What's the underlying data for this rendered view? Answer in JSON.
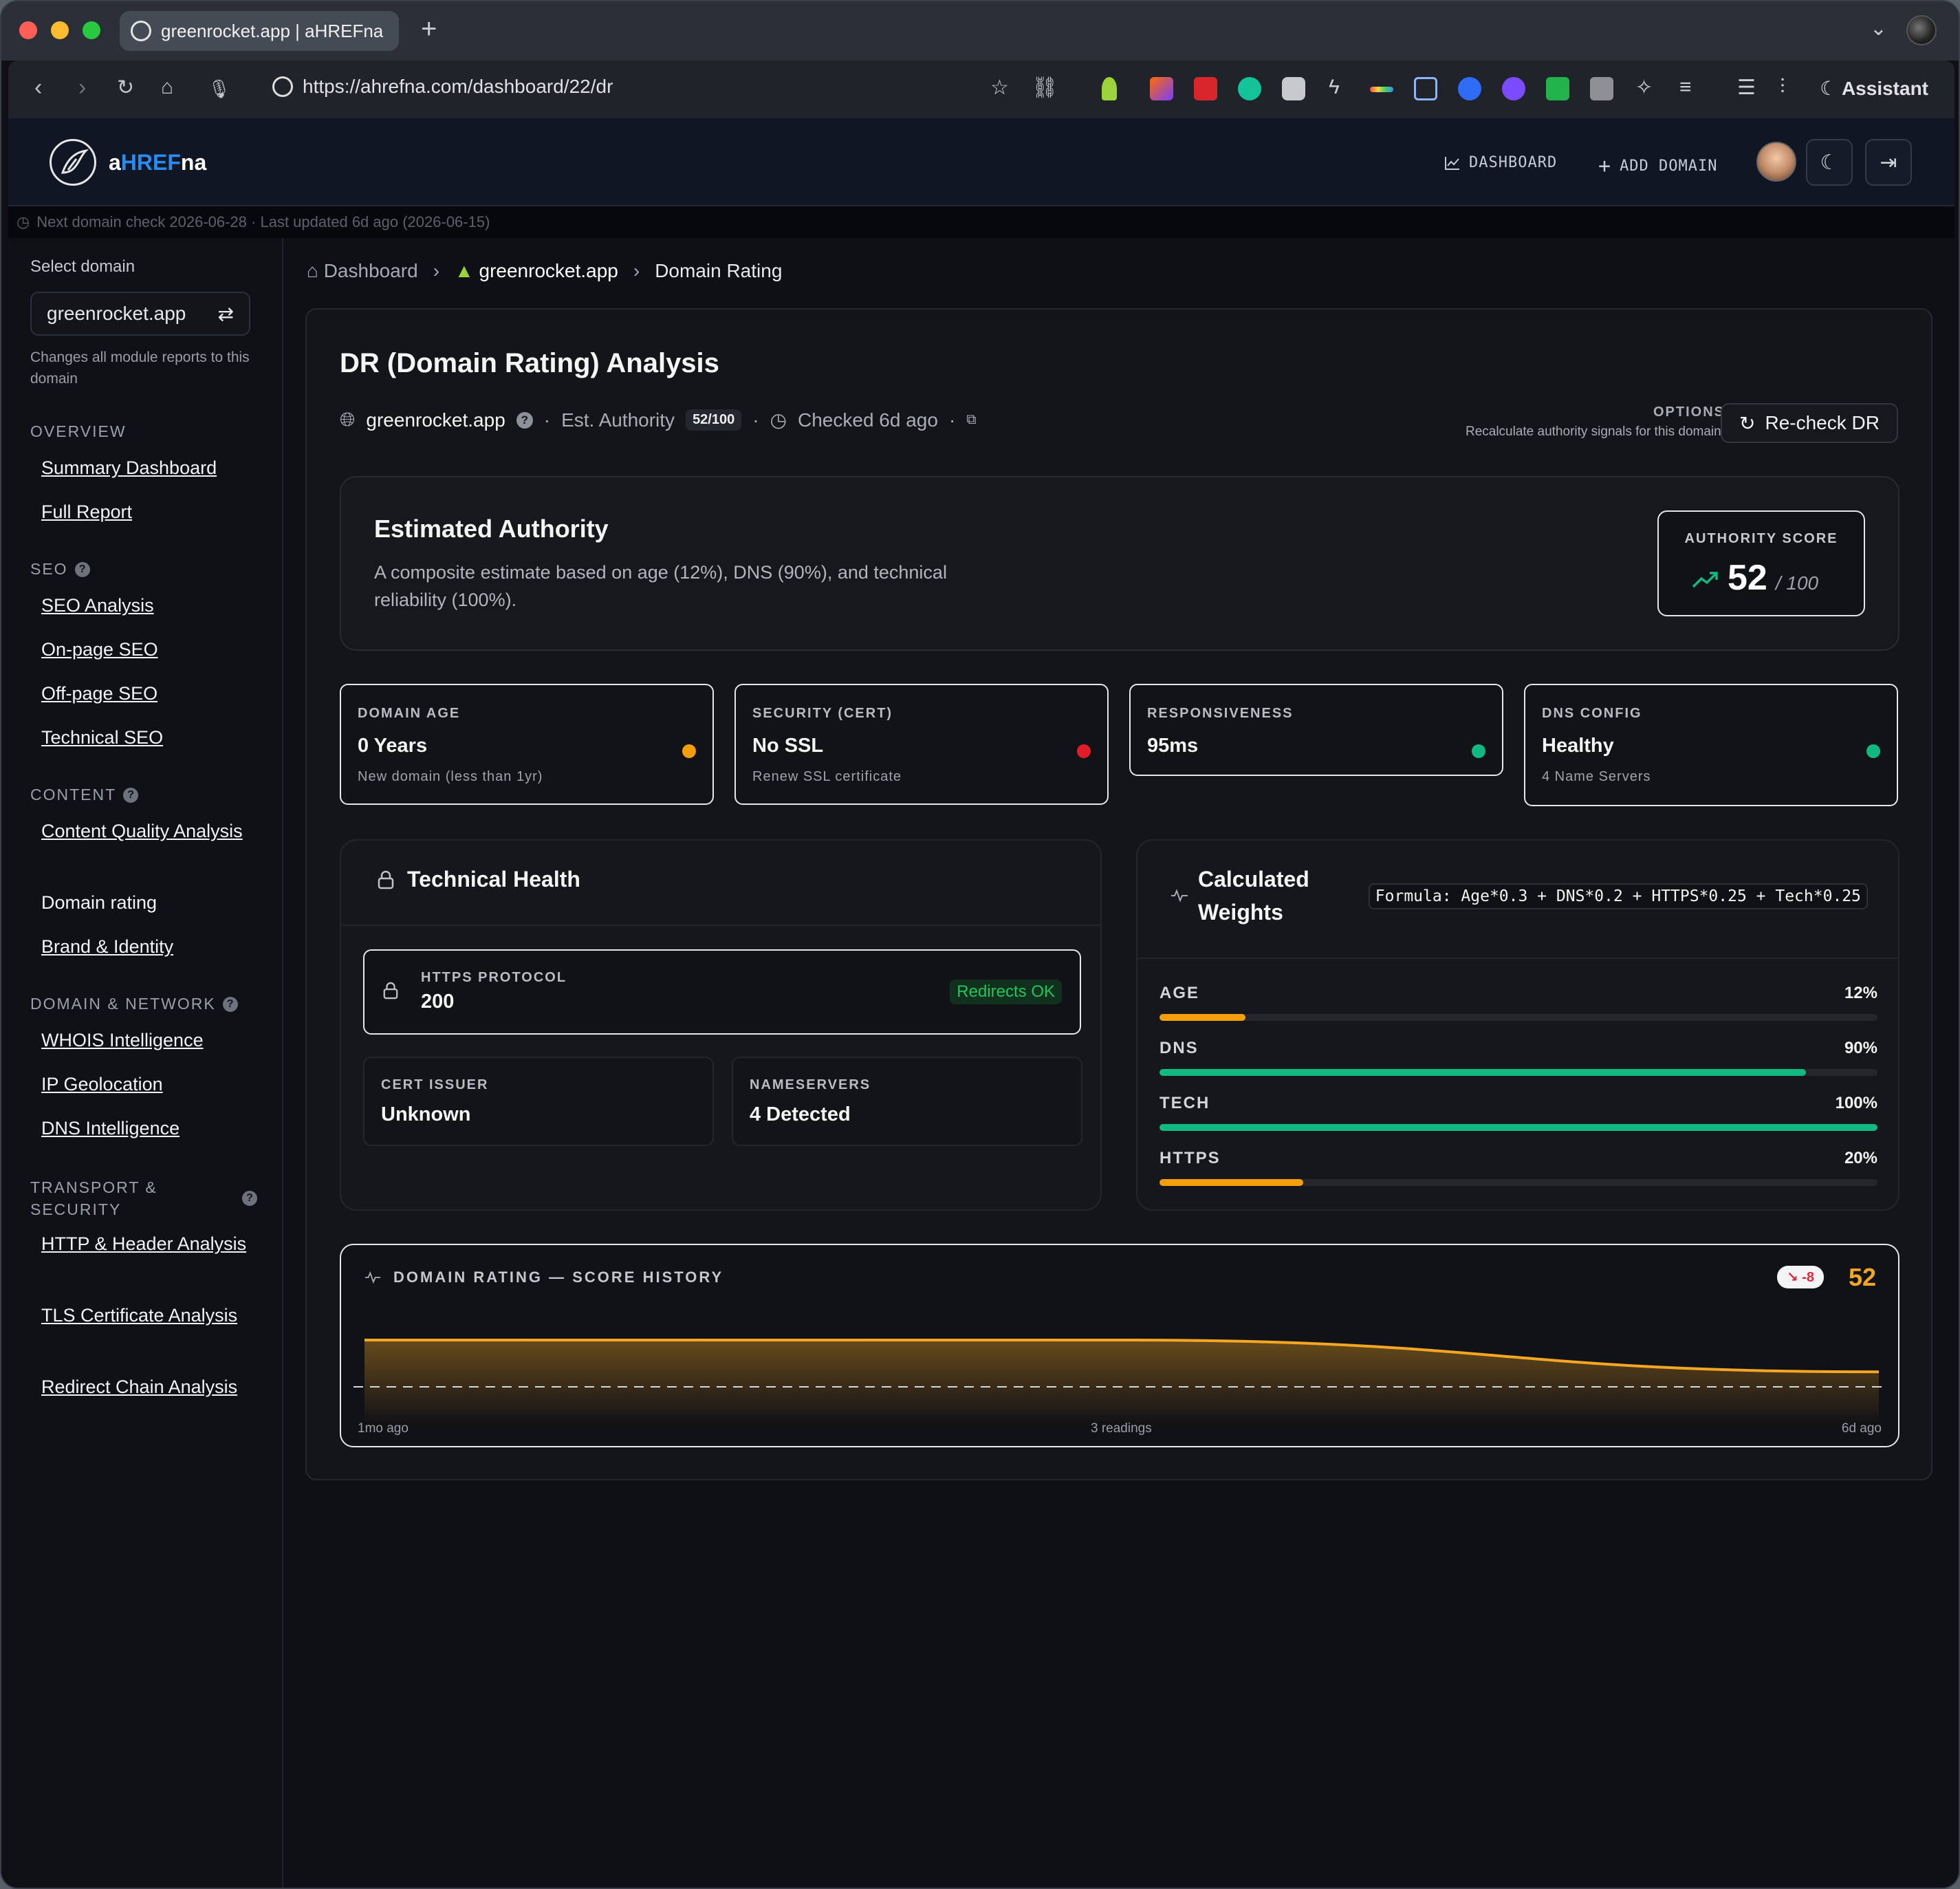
{
  "browser": {
    "tab_title": "greenrocket.app | aHREFna",
    "url": "https://ahrefna.com/dashboard/22/dr",
    "assistant_label": "Assistant"
  },
  "header": {
    "logo_prefix": "a",
    "logo_highlight": "HREF",
    "logo_suffix": "na",
    "nav_dashboard": "DASHBOARD",
    "nav_add_domain": "ADD DOMAIN"
  },
  "status": {
    "text": "Next domain check 2026-06-28 · Last updated 6d ago (2026-06-15)"
  },
  "sidebar": {
    "select_label": "Select domain",
    "selected_domain": "greenrocket.app",
    "select_help": "Changes all module reports to this domain",
    "sections": [
      {
        "title": "OVERVIEW",
        "links": [
          "Summary Dashboard",
          "Full Report"
        ]
      },
      {
        "title": "SEO",
        "links": [
          "SEO Analysis",
          "On-page SEO",
          "Off-page SEO",
          "Technical SEO"
        ]
      },
      {
        "title": "CONTENT",
        "links": [
          "Content Quality Analysis",
          "Domain rating",
          "Brand & Identity"
        ]
      },
      {
        "title": "DOMAIN & NETWORK",
        "links": [
          "WHOIS Intelligence",
          "IP Geolocation",
          "DNS Intelligence"
        ]
      },
      {
        "title": "TRANSPORT & SECURITY",
        "links": [
          "HTTP & Header Analysis",
          "TLS Certificate Analysis",
          "Redirect Chain Analysis"
        ]
      }
    ]
  },
  "breadcrumb": {
    "home": "Dashboard",
    "site": "greenrocket.app",
    "current": "Domain Rating"
  },
  "page": {
    "title": "DR (Domain Rating) Analysis",
    "site": "greenrocket.app",
    "est_authority_label": "Est. Authority",
    "est_authority_value": "52/100",
    "checked": "Checked 6d ago",
    "options_label": "OPTIONS",
    "options_help": "Recalculate authority signals for this domain.",
    "recheck_label": "Re-check DR"
  },
  "authority": {
    "heading": "Estimated Authority",
    "description": "A composite estimate based on age (12%), DNS (90%), and technical reliability (100%).",
    "score_label": "AUTHORITY SCORE",
    "score": "52",
    "score_max": "/ 100"
  },
  "metrics": [
    {
      "title": "DOMAIN AGE",
      "value": "0 Years",
      "sub": "New domain (less than 1yr)",
      "status_color": "#f59e0b"
    },
    {
      "title": "SECURITY (CERT)",
      "value": "No SSL",
      "sub": "Renew SSL certificate",
      "status_color": "#e11d2a"
    },
    {
      "title": "RESPONSIVENESS",
      "value": "95ms",
      "sub": "",
      "status_color": "#10b981"
    },
    {
      "title": "DNS CONFIG",
      "value": "Healthy",
      "sub": "4 Name Servers",
      "status_color": "#10b981"
    }
  ],
  "technical": {
    "heading": "Technical Health",
    "https_label": "HTTPS PROTOCOL",
    "https_value": "200",
    "https_badge": "Redirects OK",
    "cert_label": "CERT ISSUER",
    "cert_value": "Unknown",
    "ns_label": "NAMESERVERS",
    "ns_value": "4 Detected"
  },
  "weights": {
    "heading": "Calculated Weights",
    "formula": "Formula: Age*0.3 + DNS*0.2 + HTTPS*0.25 + Tech*0.25",
    "rows": [
      {
        "label": "AGE",
        "pct_text": "12%",
        "value": 12,
        "color": "#f59e0b"
      },
      {
        "label": "DNS",
        "pct_text": "90%",
        "value": 90,
        "color": "#10b981"
      },
      {
        "label": "TECH",
        "pct_text": "100%",
        "value": 100,
        "color": "#10b981"
      },
      {
        "label": "HTTPS",
        "pct_text": "20%",
        "value": 20,
        "color": "#f59e0b"
      }
    ]
  },
  "history": {
    "title": "DOMAIN RATING — SCORE HISTORY",
    "delta": "-8",
    "current": "52",
    "axis_left": "1mo ago",
    "axis_mid": "3 readings",
    "axis_right": "6d ago"
  },
  "chart_data": {
    "type": "area",
    "title": "DOMAIN RATING — SCORE HISTORY",
    "x": [
      "1mo ago",
      "",
      "6d ago"
    ],
    "series": [
      {
        "values": [
          60,
          60,
          52
        ]
      }
    ],
    "line_color": "#f5a623"
  }
}
